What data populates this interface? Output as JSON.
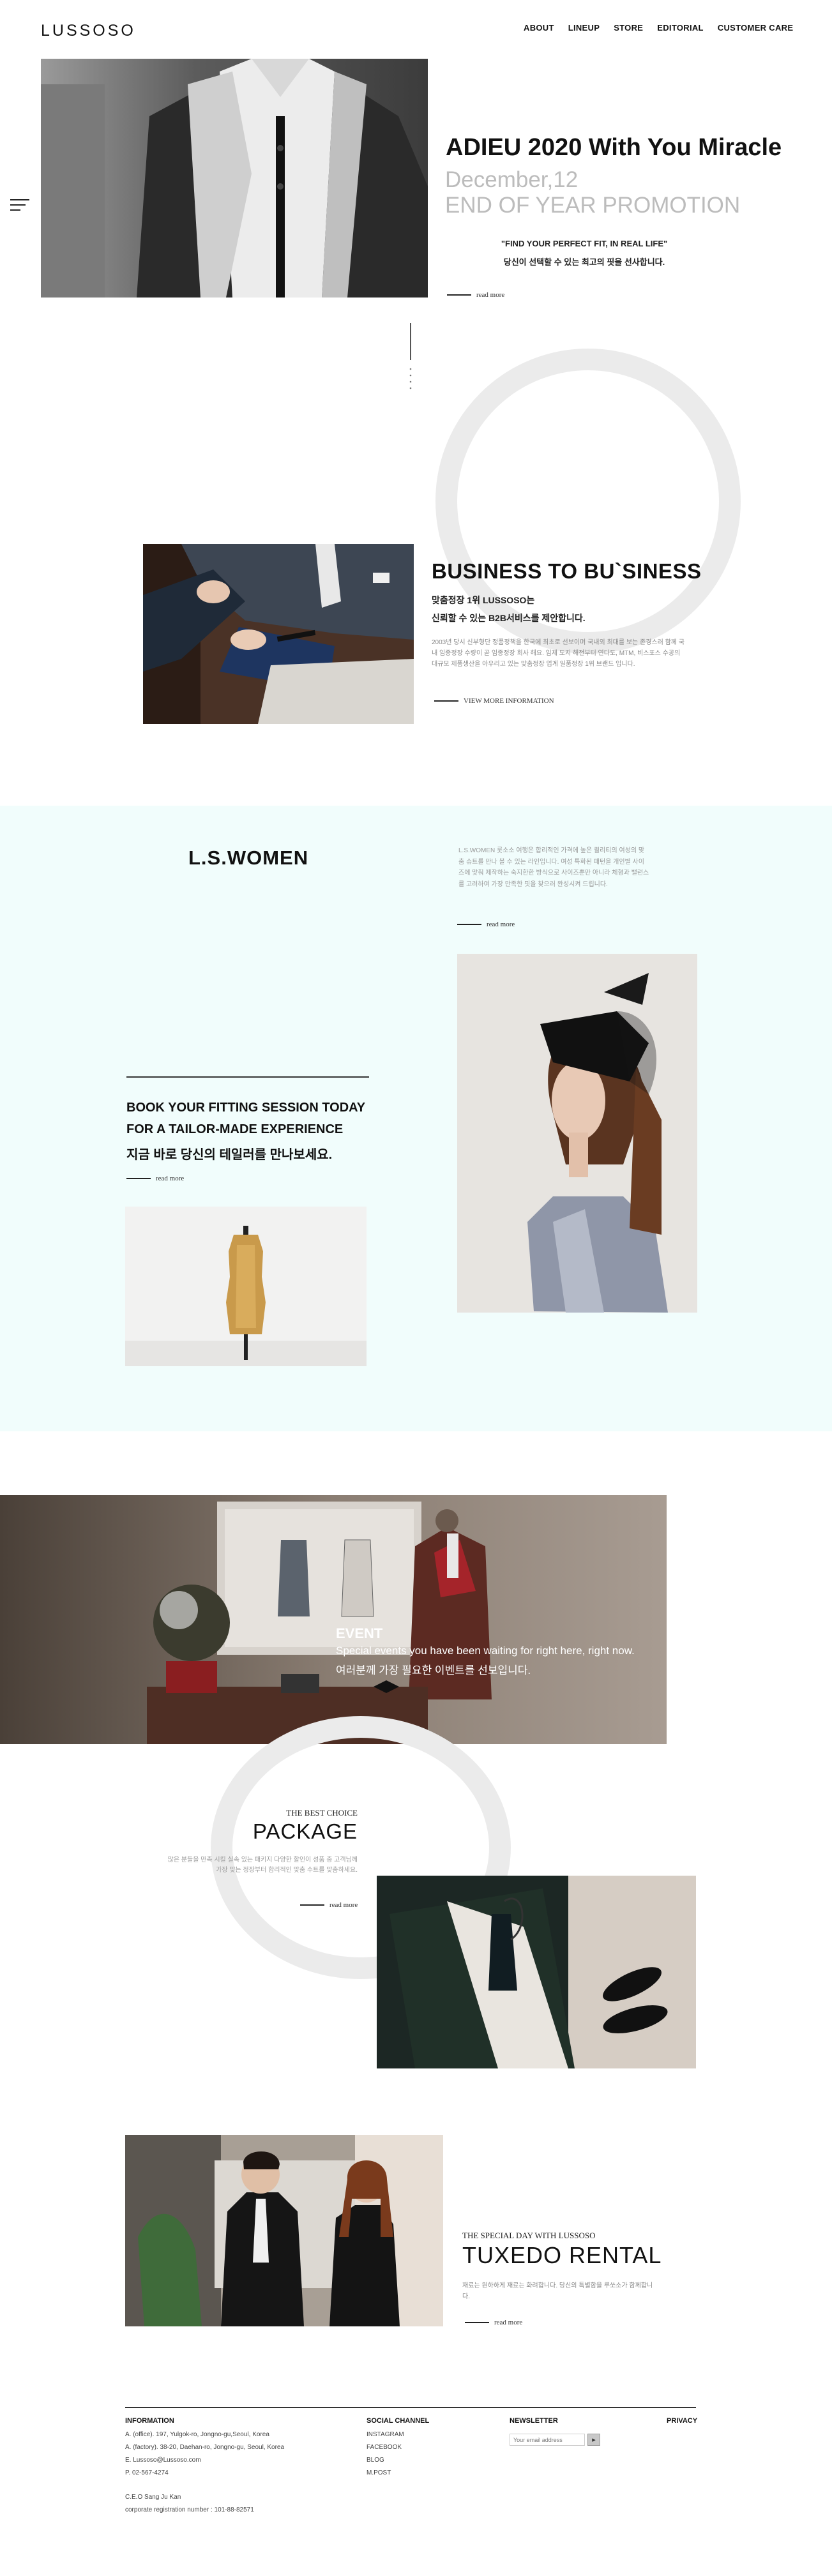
{
  "header": {
    "logo": "LUSSOSO",
    "nav": [
      "ABOUT",
      "LINEUP",
      "STORE",
      "EDITORIAL",
      "CUSTOMER CARE"
    ]
  },
  "hero": {
    "title": "ADIEU 2020 With You Miracle",
    "date": "December,12",
    "promo": "END OF YEAR PROMOTION",
    "quote": "\"FIND YOUR PERFECT FIT, IN REAL LIFE\"",
    "korean": "당신이 선택할 수 있는 최고의 핏을 선사합니다.",
    "read_more": "read more"
  },
  "business": {
    "title": "BUSINESS TO BU`SINESS",
    "sub1": "맞춤정장 1위 LUSSOSO는",
    "sub2": "신뢰할 수 있는 B2B서비스를 제안합니다.",
    "body": "2003년 당시 신부형단 정품정책을 한국에 최초로 선보이며 국내외 최대를 보는 존경스러 함께 국내 임종정장 수량이 곧 임종정장 회사 해요. 임제 도지 해전부터 연다도, MTM, 비스포스 수공의 대규모 제품생산을 아우리고 있는 맞춤정장 업계 일품정장 1위 브랜드 입니다.",
    "link": "VIEW MORE INFORMATION"
  },
  "women": {
    "title": "L.S.WOMEN",
    "body": "L.S.WOMEN 룻소소 여행은 합리적인 가격에 높은 퀄리티의 여성의 맞춤 슈트를 만나 볼 수 있는 라인입니다. 여성 특화된 패턴을 개인별 사이즈에 맞춰 제작하는 숙지한한 방식으로 사이즈뿐만 아니라 체형과 밸런스를 고려하여 가장 만족한 핏을 찾으러 완성시켜 드립니다.",
    "read_more": "read more",
    "fitting1": "BOOK YOUR FITTING SESSION TODAY",
    "fitting2": "FOR A TAILOR-MADE EXPERIENCE",
    "fitting3": "지금 바로 당신의 테일러를 만나보세요.",
    "fitting_read_more": "read more"
  },
  "event": {
    "title": "EVENT",
    "line1": "Special events you have been waiting for right here, right now.",
    "line2": "여러분께 가장 필요한 이벤트를 선보입니다."
  },
  "package": {
    "kicker": "THE BEST CHOICE",
    "title": "PACKAGE",
    "body": "많은 분들을 만족 시킬 실속 있는 패키지 다양한 할인이 성품 중 고객님께 가장 맞는 정장부터 합리적인 맞춤 수트를 맞춤하세요.",
    "read_more": "read more"
  },
  "tuxedo": {
    "kicker": "THE SPECIAL DAY WITH LUSSOSO",
    "title": "TUXEDO RENTAL",
    "body": "재료는 원하하게 재료는 화려합니다. 당신의 특별함을 루쏘소가 함께합니다.",
    "read_more": "read more"
  },
  "footer": {
    "info": {
      "title": "INFORMATION",
      "office": "A. (office). 197, Yulgok-ro, Jongno-gu,Seoul, Korea",
      "factory": "A. (factory). 38-20, Daehan-ro, Jongno-gu, Seoul, Korea",
      "email": "E. Lussoso@Lussoso.com",
      "phone": "P. 02-567-4274",
      "ceo": "C.E.O Sang Ju Kan",
      "reg": "corporate registration number : 101-88-82571"
    },
    "social": {
      "title": "SOCIAL CHANNEL",
      "items": [
        "INSTAGRAM",
        "FACEBOOK",
        "BLOG",
        "M.POST"
      ]
    },
    "newsletter": {
      "title": "NEWSLETTER",
      "placeholder": "Your email address"
    },
    "privacy": "PRIVACY"
  },
  "colors": {
    "mint_bg": "#f1fdfc",
    "ring": "#ebebeb",
    "grey_text": "#bcbcbc"
  }
}
